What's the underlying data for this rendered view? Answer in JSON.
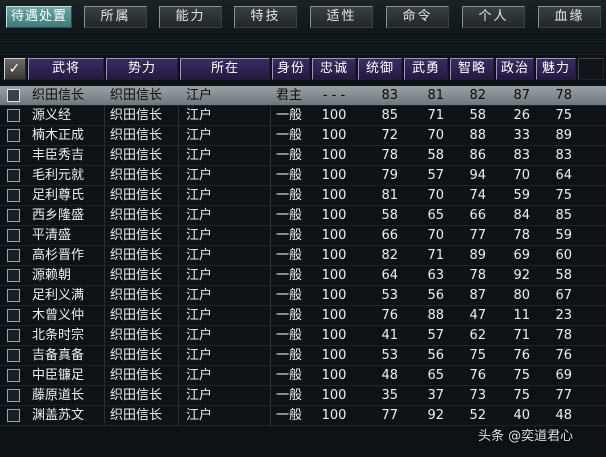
{
  "tabs": [
    "待遇处置",
    "所属",
    "能力",
    "特技",
    "适性",
    "命令",
    "个人",
    "血缘"
  ],
  "active_tab_index": 0,
  "header": {
    "check": "✓",
    "columns": [
      "武将",
      "势力",
      "所在",
      "身份",
      "忠诚",
      "统御",
      "武勇",
      "智略",
      "政治",
      "魅力"
    ]
  },
  "rows": [
    {
      "name": "织田信长",
      "faction": "织田信长",
      "location": "江户",
      "status": "君主",
      "loyalty": "- - -",
      "command": "83",
      "valor": "81",
      "strategy": "82",
      "politics": "87",
      "charm": "78",
      "selected": true
    },
    {
      "name": "源义经",
      "faction": "织田信长",
      "location": "江户",
      "status": "一般",
      "loyalty": "100",
      "command": "85",
      "valor": "71",
      "strategy": "58",
      "politics": "26",
      "charm": "75"
    },
    {
      "name": "楠木正成",
      "faction": "织田信长",
      "location": "江户",
      "status": "一般",
      "loyalty": "100",
      "command": "72",
      "valor": "70",
      "strategy": "88",
      "politics": "33",
      "charm": "89"
    },
    {
      "name": "丰臣秀吉",
      "faction": "织田信长",
      "location": "江户",
      "status": "一般",
      "loyalty": "100",
      "command": "78",
      "valor": "58",
      "strategy": "86",
      "politics": "83",
      "charm": "83"
    },
    {
      "name": "毛利元就",
      "faction": "织田信长",
      "location": "江户",
      "status": "一般",
      "loyalty": "100",
      "command": "79",
      "valor": "57",
      "strategy": "94",
      "politics": "70",
      "charm": "64"
    },
    {
      "name": "足利尊氏",
      "faction": "织田信长",
      "location": "江户",
      "status": "一般",
      "loyalty": "100",
      "command": "81",
      "valor": "70",
      "strategy": "74",
      "politics": "59",
      "charm": "75"
    },
    {
      "name": "西乡隆盛",
      "faction": "织田信长",
      "location": "江户",
      "status": "一般",
      "loyalty": "100",
      "command": "58",
      "valor": "65",
      "strategy": "66",
      "politics": "84",
      "charm": "85"
    },
    {
      "name": "平清盛",
      "faction": "织田信长",
      "location": "江户",
      "status": "一般",
      "loyalty": "100",
      "command": "66",
      "valor": "70",
      "strategy": "77",
      "politics": "78",
      "charm": "59"
    },
    {
      "name": "高杉晋作",
      "faction": "织田信长",
      "location": "江户",
      "status": "一般",
      "loyalty": "100",
      "command": "82",
      "valor": "71",
      "strategy": "89",
      "politics": "69",
      "charm": "60"
    },
    {
      "name": "源赖朝",
      "faction": "织田信长",
      "location": "江户",
      "status": "一般",
      "loyalty": "100",
      "command": "64",
      "valor": "63",
      "strategy": "78",
      "politics": "92",
      "charm": "58"
    },
    {
      "name": "足利义满",
      "faction": "织田信长",
      "location": "江户",
      "status": "一般",
      "loyalty": "100",
      "command": "53",
      "valor": "56",
      "strategy": "87",
      "politics": "80",
      "charm": "67"
    },
    {
      "name": "木曾义仲",
      "faction": "织田信长",
      "location": "江户",
      "status": "一般",
      "loyalty": "100",
      "command": "76",
      "valor": "88",
      "strategy": "47",
      "politics": "11",
      "charm": "23"
    },
    {
      "name": "北条时宗",
      "faction": "织田信长",
      "location": "江户",
      "status": "一般",
      "loyalty": "100",
      "command": "41",
      "valor": "57",
      "strategy": "62",
      "politics": "71",
      "charm": "78"
    },
    {
      "name": "吉备真备",
      "faction": "织田信长",
      "location": "江户",
      "status": "一般",
      "loyalty": "100",
      "command": "53",
      "valor": "56",
      "strategy": "75",
      "politics": "76",
      "charm": "76"
    },
    {
      "name": "中臣镰足",
      "faction": "织田信长",
      "location": "江户",
      "status": "一般",
      "loyalty": "100",
      "command": "48",
      "valor": "65",
      "strategy": "76",
      "politics": "75",
      "charm": "69"
    },
    {
      "name": "藤原道长",
      "faction": "织田信长",
      "location": "江户",
      "status": "一般",
      "loyalty": "100",
      "command": "35",
      "valor": "37",
      "strategy": "73",
      "politics": "75",
      "charm": "77"
    },
    {
      "name": "渊盖苏文",
      "faction": "织田信长",
      "location": "江户",
      "status": "一般",
      "loyalty": "100",
      "command": "77",
      "valor": "92",
      "strategy": "52",
      "politics": "40",
      "charm": "48"
    }
  ],
  "watermark": "头条 @奕道君心"
}
